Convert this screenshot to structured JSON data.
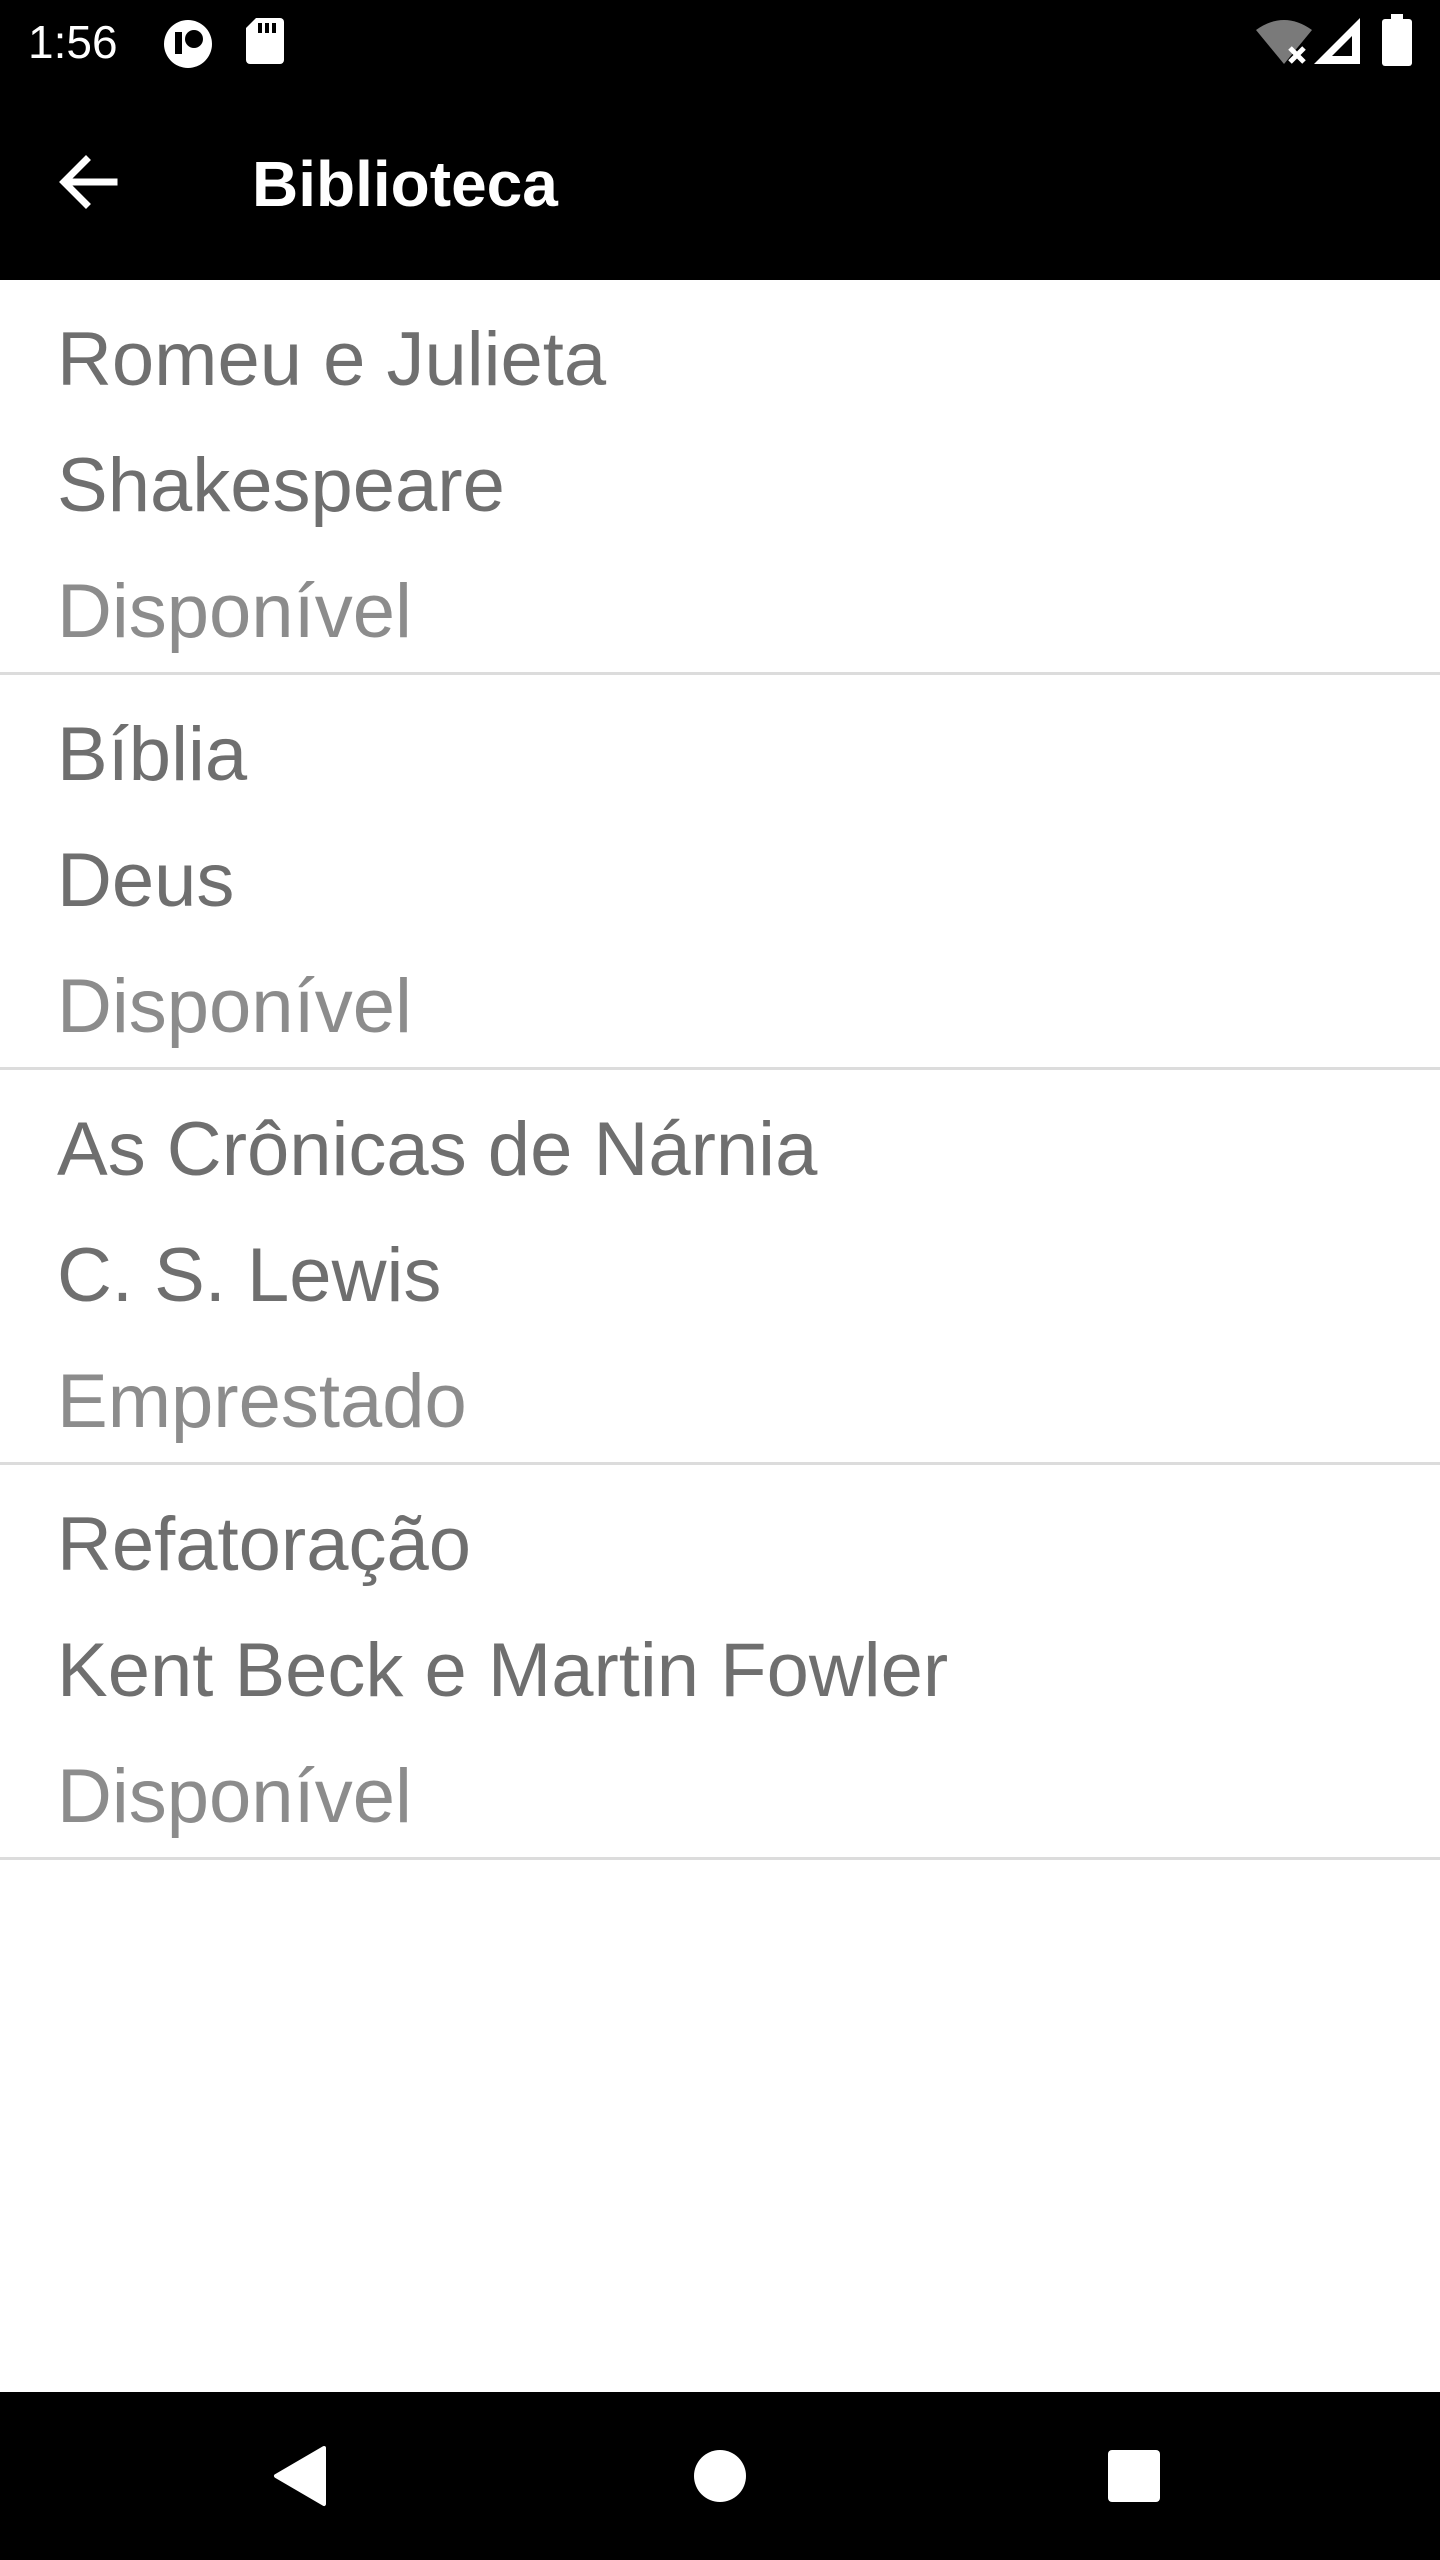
{
  "status_bar": {
    "time": "1:56",
    "icons": [
      "sync-circle-icon",
      "sd-card-icon",
      "wifi-off-icon",
      "cellular-signal-icon",
      "battery-icon"
    ]
  },
  "app_bar": {
    "title": "Biblioteca",
    "back_icon": "arrow-back-icon"
  },
  "books": [
    {
      "title": "Romeu e Julieta",
      "author": "Shakespeare",
      "status": "Disponível"
    },
    {
      "title": "Bíblia",
      "author": "Deus",
      "status": "Disponível"
    },
    {
      "title": "As Crônicas de Nárnia",
      "author": "C. S. Lewis",
      "status": "Emprestado"
    },
    {
      "title": "Refatoração",
      "author": "Kent Beck e Martin Fowler",
      "status": "Disponível"
    }
  ],
  "nav_bar": {
    "icons": [
      "back-triangle-icon",
      "home-circle-icon",
      "recents-square-icon"
    ]
  },
  "colors": {
    "bar_background": "#000000",
    "bar_foreground": "#ffffff",
    "list_text": "#6f6f6f",
    "status_text": "#8c8c8c",
    "divider": "#dcdcdc"
  }
}
